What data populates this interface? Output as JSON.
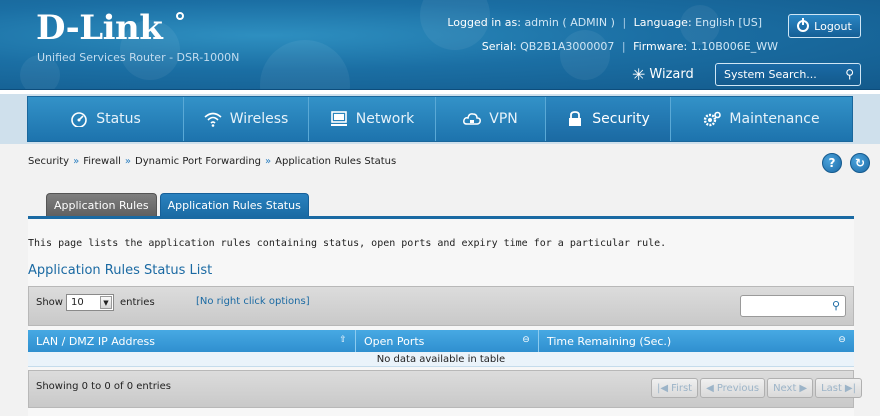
{
  "header": {
    "brand": "D-Link",
    "product": "Unified Services Router - DSR-1000N",
    "logged_in_label": "Logged in as:",
    "logged_in_user": "admin ( ADMIN )",
    "language_label": "Language:",
    "language_value": "English [US]",
    "serial_label": "Serial:",
    "serial_value": "QB2B1A3000007",
    "firmware_label": "Firmware:",
    "firmware_value": "1.10B006E_WW",
    "logout_label": "Logout",
    "wizard_label": "Wizard",
    "search_placeholder": "System Search..."
  },
  "nav": {
    "items": [
      {
        "label": "Status",
        "icon": "gauge-icon"
      },
      {
        "label": "Wireless",
        "icon": "wifi-icon"
      },
      {
        "label": "Network",
        "icon": "monitor-icon"
      },
      {
        "label": "VPN",
        "icon": "cloud-lock-icon"
      },
      {
        "label": "Security",
        "icon": "padlock-icon"
      },
      {
        "label": "Maintenance",
        "icon": "gears-icon"
      }
    ],
    "active": "Security"
  },
  "breadcrumb": {
    "items": [
      "Security",
      "Firewall",
      "Dynamic Port Forwarding",
      "Application Rules Status"
    ],
    "separator": "»"
  },
  "tabs": {
    "items": [
      "Application Rules",
      "Application Rules Status"
    ],
    "active": "Application Rules Status"
  },
  "page": {
    "description": "This page lists the application rules containing status, open ports and expiry time for a particular rule.",
    "list_title": "Application Rules Status List"
  },
  "table": {
    "show_label": "Show",
    "entries_value": "10",
    "entries_label": "entries",
    "right_click_label": "[No right click options]",
    "columns": [
      "LAN / DMZ IP Address",
      "Open Ports",
      "Time Remaining (Sec.)"
    ],
    "empty_message": "No data available in table",
    "info": "Showing 0 to 0 of 0 entries",
    "pager": [
      "First",
      "Previous",
      "Next",
      "Last"
    ]
  },
  "colors": {
    "brand_blue": "#1b6aa3",
    "header_bg": "#1b6fa4",
    "table_header": "#3b9cdb"
  }
}
